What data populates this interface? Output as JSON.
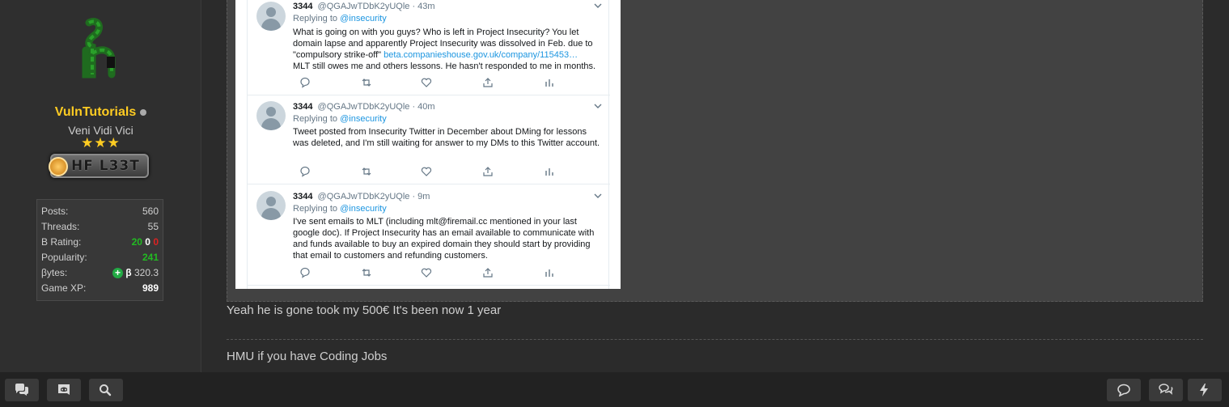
{
  "user": {
    "name": "VulnTutorials",
    "title": "Veni Vidi Vici",
    "stars": "★★★",
    "badge": "HF L33T",
    "avatar_icon": "letter-h-avatar-icon"
  },
  "stats": {
    "posts_label": "Posts:",
    "posts": "560",
    "threads_label": "Threads:",
    "threads": "55",
    "brating_label": "B Rating:",
    "brating_pos": "20",
    "brating_neu": "0",
    "brating_neg": "0",
    "popularity_label": "Popularity:",
    "popularity": "241",
    "bytes_label": "βytes:",
    "bytes_symbol": "β",
    "bytes": "320.3",
    "xp_label": "Game XP:",
    "xp": "989"
  },
  "tweets": [
    {
      "name": "3344",
      "handle": "@QGAJwTDbK2yUQle · 43m",
      "replying": "Replying to",
      "reply_to": "@insecurity",
      "text_1": "What is going on with you guys? Who is left in Project Insecurity? You let domain lapse and apparently Project Insecurity was dissolved in Feb. due to \"compulsory strike-off\"",
      "link": "beta.companieshouse.gov.uk/company/115453…",
      "text_2": "MLT still owes me and others lessons. He hasn't responded to me in months."
    },
    {
      "name": "3344",
      "handle": "@QGAJwTDbK2yUQle · 40m",
      "replying": "Replying to",
      "reply_to": "@insecurity",
      "text_1": "Tweet posted from Insecurity Twitter in December about DMing for lessons was deleted, and I'm still waiting for answer to my DMs to this Twitter account."
    },
    {
      "name": "3344",
      "handle": "@QGAJwTDbK2yUQle · 9m",
      "replying": "Replying to",
      "reply_to": "@insecurity",
      "text_1": "I've sent emails to MLT (including mlt@firemail.cc mentioned in your last google doc). If Project Insecurity has an email available to communicate with and funds available to buy an expired domain they should start by providing that email to customers and refunding customers."
    }
  ],
  "post": {
    "text": "Yeah he is gone took my 500€ It's been now 1 year",
    "signature": "HMU if you have Coding Jobs"
  },
  "bottombar": {
    "left_icons": [
      "chat-bubbles-icon",
      "discord-icon",
      "search-icon"
    ],
    "right_icons": [
      "comment-icon",
      "conversations-icon",
      "lightning-icon"
    ]
  },
  "colors": {
    "username": "#ffcc22",
    "positive": "#22bb22",
    "negative": "#dd2222",
    "twitter_link": "#1b95e0"
  }
}
